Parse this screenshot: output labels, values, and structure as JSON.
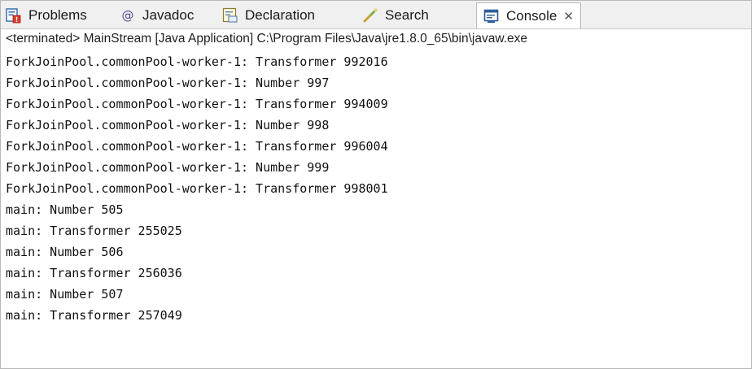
{
  "tabs": [
    {
      "label": "Problems",
      "icon": "problems-icon"
    },
    {
      "label": "Javadoc",
      "icon": "javadoc-icon"
    },
    {
      "label": "Declaration",
      "icon": "declaration-icon"
    },
    {
      "label": "Search",
      "icon": "search-icon"
    },
    {
      "label": "Console",
      "icon": "console-icon",
      "active": true
    }
  ],
  "close_label": "✕",
  "status": "<terminated> MainStream [Java Application] C:\\Program Files\\Java\\jre1.8.0_65\\bin\\javaw.exe",
  "console_lines": [
    "ForkJoinPool.commonPool-worker-1: Transformer 992016",
    "ForkJoinPool.commonPool-worker-1: Number 997",
    "ForkJoinPool.commonPool-worker-1: Transformer 994009",
    "ForkJoinPool.commonPool-worker-1: Number 998",
    "ForkJoinPool.commonPool-worker-1: Transformer 996004",
    "ForkJoinPool.commonPool-worker-1: Number 999",
    "ForkJoinPool.commonPool-worker-1: Transformer 998001",
    "main: Number 505",
    "main: Transformer 255025",
    "main: Number 506",
    "main: Transformer 256036",
    "main: Number 507",
    "main: Transformer 257049"
  ]
}
